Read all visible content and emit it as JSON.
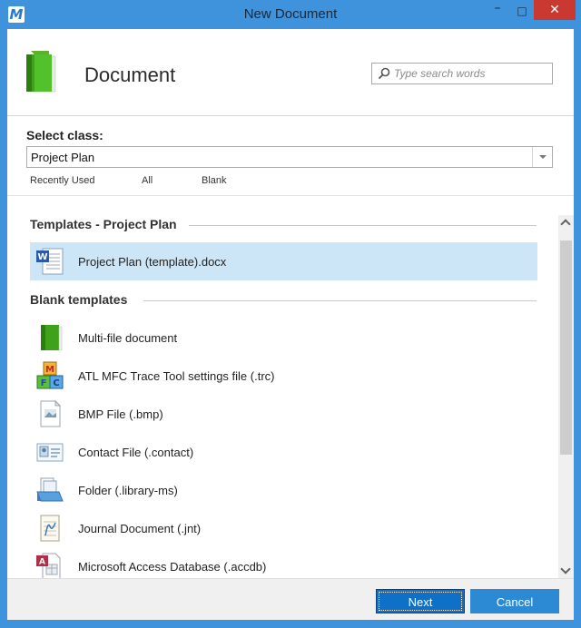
{
  "window": {
    "title": "New Document",
    "app_icon_letter": "M",
    "minimize": "–",
    "maximize": "□",
    "close": "✕"
  },
  "header": {
    "heading": "Document",
    "search_placeholder": "Type search words"
  },
  "class_select": {
    "label": "Select class:",
    "value": "Project Plan"
  },
  "filters": [
    "Recently Used",
    "All",
    "Blank"
  ],
  "sections": {
    "templates": {
      "title": "Templates - Project Plan",
      "items": [
        {
          "label": "Project Plan (template).docx",
          "icon": "word-document-icon",
          "selected": true
        }
      ]
    },
    "blank": {
      "title": "Blank templates",
      "items": [
        {
          "label": "Multi-file document",
          "icon": "green-book-icon"
        },
        {
          "label": "ATL MFC Trace Tool settings file (.trc)",
          "icon": "mfc-blocks-icon"
        },
        {
          "label": "BMP File (.bmp)",
          "icon": "bmp-file-icon"
        },
        {
          "label": "Contact File (.contact)",
          "icon": "contact-card-icon"
        },
        {
          "label": "Folder (.library-ms)",
          "icon": "library-folder-icon"
        },
        {
          "label": "Journal Document (.jnt)",
          "icon": "journal-icon"
        },
        {
          "label": "Microsoft Access Database (.accdb)",
          "icon": "access-database-icon"
        }
      ]
    }
  },
  "buttons": {
    "next": "Next",
    "cancel": "Cancel"
  },
  "colors": {
    "title_bar": "#3f93dd",
    "close_button": "#c9392f",
    "selection": "#cde6f7",
    "primary_button": "#0f70c8",
    "secondary_button": "#2b8ad3"
  }
}
